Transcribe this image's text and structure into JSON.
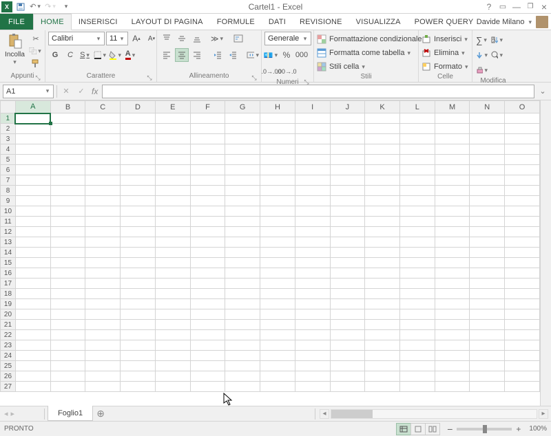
{
  "title": "Cartel1 - Excel",
  "user": "Davide Milano",
  "tabs": {
    "file": "FILE",
    "list": [
      "HOME",
      "INSERISCI",
      "LAYOUT DI PAGINA",
      "FORMULE",
      "DATI",
      "REVISIONE",
      "VISUALIZZA",
      "POWER QUERY"
    ],
    "active": 0
  },
  "ribbon": {
    "clipboard": {
      "paste": "Incolla",
      "label": "Appunti"
    },
    "font": {
      "name": "Calibri",
      "size": "11",
      "label": "Carattere",
      "bold": "G",
      "italic": "C",
      "underline": "S"
    },
    "alignment": {
      "label": "Allineamento"
    },
    "number": {
      "format": "Generale",
      "label": "Numeri"
    },
    "styles": {
      "cond": "Formattazione condizionale",
      "table": "Formatta come tabella",
      "cell": "Stili cella",
      "label": "Stili"
    },
    "cells": {
      "insert": "Inserisci",
      "delete": "Elimina",
      "format": "Formato",
      "label": "Celle"
    },
    "editing": {
      "label": "Modifica"
    }
  },
  "namebox": "A1",
  "columns": [
    "A",
    "B",
    "C",
    "D",
    "E",
    "F",
    "G",
    "H",
    "I",
    "J",
    "K",
    "L",
    "M",
    "N",
    "O"
  ],
  "rows": [
    1,
    2,
    3,
    4,
    5,
    6,
    7,
    8,
    9,
    10,
    11,
    12,
    13,
    14,
    15,
    16,
    17,
    18,
    19,
    20,
    21,
    22,
    23,
    24,
    25,
    26,
    27
  ],
  "sheet_tab": "Foglio1",
  "status": "PRONTO",
  "zoom": "100%"
}
